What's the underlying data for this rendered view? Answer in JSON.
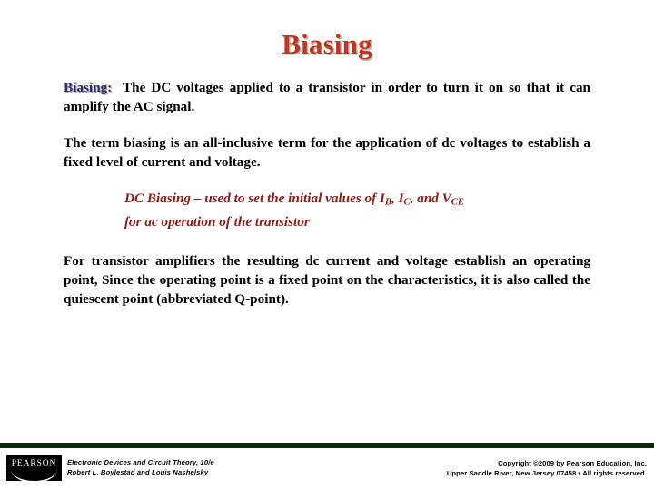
{
  "slide": {
    "title": "Biasing",
    "title_color": "#c1361f",
    "accent_rule_color": "#0c2b0c"
  },
  "content": {
    "paragraph1": {
      "label": "Biasing:",
      "label_color": "#2b2b6b",
      "text": "The DC voltages applied to a transistor in order to turn it on so that it can amplify the AC signal."
    },
    "paragraph2": {
      "text": "The term biasing is an all-inclusive term for the application of dc voltages to establish a fixed level of current and voltage."
    },
    "highlight": {
      "color": "#8e1a14",
      "line1_prefix": "DC Biasing – used to set the initial values of I",
      "sub1": "B",
      "line1_mid1": ", I",
      "sub2": "C",
      "line1_mid2": ", and V",
      "sub3": "CE",
      "line2": "for ac operation of the transistor"
    },
    "paragraph4": {
      "text": "For transistor amplifiers the resulting dc current and voltage establish an operating point, Since the operating point is a fixed point on the characteristics, it is also called the quiescent point (abbreviated Q-point)."
    }
  },
  "footer": {
    "logo_text": "PEARSON",
    "book_title": "Electronic Devices and Circuit Theory, 10/e",
    "book_authors": "Robert L. Boylestad and Louis Nashelsky",
    "copyright_line1": "Copyright ©2009 by Pearson Education, Inc.",
    "copyright_line2": "Upper Saddle River, New Jersey 07458 • All rights reserved."
  }
}
